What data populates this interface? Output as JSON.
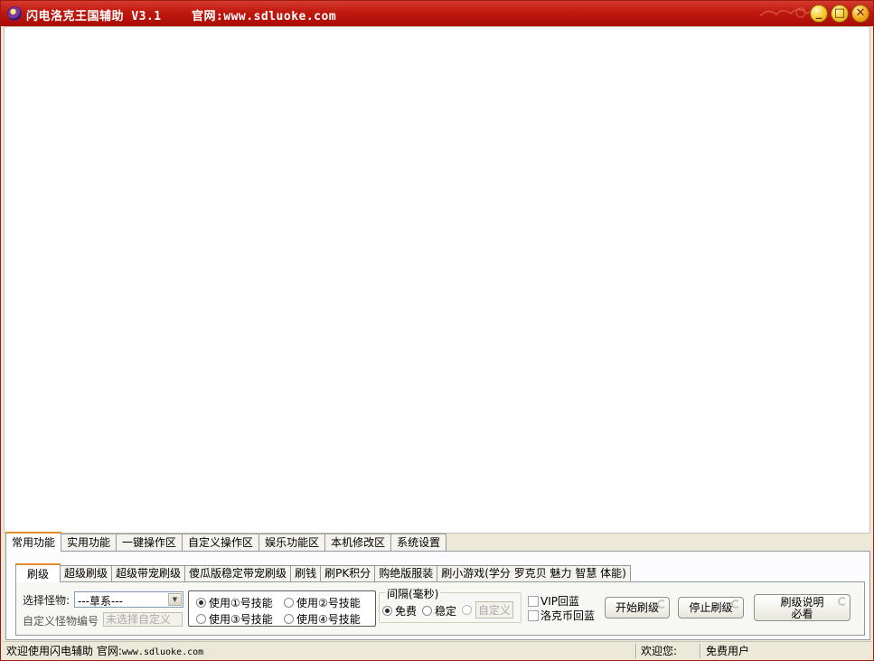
{
  "window": {
    "title": "闪电洛克王国辅助 V3.1    官网:www.sdluoke.com",
    "minimize_glyph": "_",
    "maximize_glyph": "□",
    "close_glyph": "✕",
    "colors": {
      "titlebar": "#c0180f",
      "button": "#f5b324",
      "tab_accent": "#e68b2c"
    }
  },
  "outer_tabs": [
    "常用功能",
    "实用功能",
    "一键操作区",
    "自定义操作区",
    "娱乐功能区",
    "本机修改区",
    "系统设置"
  ],
  "inner_tabs": [
    "刷级",
    "超级刷级",
    "超级带宠刷级",
    "傻瓜版稳定带宠刷级",
    "刷钱",
    "刷PK积分",
    "购绝版服装",
    "刷小游戏(学分 罗克贝 魅力 智慧 体能)"
  ],
  "form": {
    "select_monster_label": "选择怪物:",
    "select_monster_value": "---草系---",
    "custom_monster_label": "自定义怪物编号",
    "custom_monster_placeholder": "未选择自定义",
    "skills": [
      "使用①号技能",
      "使用②号技能",
      "使用③号技能",
      "使用④号技能"
    ],
    "skill_selected": 0,
    "interval_legend": "间隔(毫秒)",
    "interval_options": [
      "免费",
      "稳定",
      "自定义"
    ],
    "interval_selected": 0,
    "checkboxes": [
      "VIP回蓝",
      "洛克币回蓝"
    ],
    "buttons": {
      "start": "开始刷级",
      "stop": "停止刷级",
      "help_line1": "刷级说明",
      "help_line2": "必看"
    }
  },
  "status": {
    "welcome": "欢迎使用闪电辅助 官网:",
    "url": "www.sdluoke.com",
    "user_label": "欢迎您:",
    "user_type": "免费用户"
  }
}
